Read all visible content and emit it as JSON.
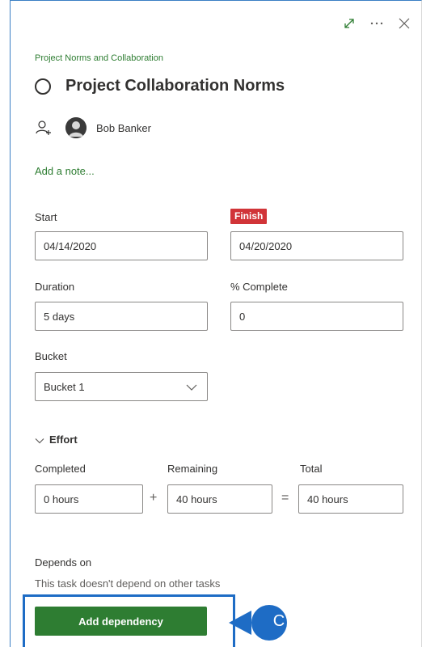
{
  "plan": {
    "name": "Project Norms and Collaboration"
  },
  "task": {
    "title": "Project Collaboration Norms",
    "assignee": "Bob Banker",
    "add_note_link": "Add a note..."
  },
  "dates": {
    "start_label": "Start",
    "start_value": "04/14/2020",
    "finish_label": "Finish",
    "finish_value": "04/20/2020"
  },
  "progress": {
    "duration_label": "Duration",
    "duration_value": "5 days",
    "complete_label": "% Complete",
    "complete_value": "0"
  },
  "bucket": {
    "label": "Bucket",
    "value": "Bucket 1"
  },
  "effort": {
    "section_title": "Effort",
    "completed_label": "Completed",
    "completed_value": "0 hours",
    "remaining_label": "Remaining",
    "remaining_value": "40 hours",
    "total_label": "Total",
    "total_value": "40 hours",
    "plus_sign": "+",
    "equals_sign": "="
  },
  "dependencies": {
    "label": "Depends on",
    "empty_text": "This task doesn't depend on other tasks",
    "add_button": "Add dependency"
  },
  "callout": {
    "letter": "C"
  },
  "icons": {
    "expand": "expand-diagonal-icon",
    "more": "more-ellipsis-icon",
    "close": "close-icon",
    "assign": "assign-person-icon",
    "chevron": "chevron-down-icon"
  },
  "colors": {
    "accent_green": "#2e7d32",
    "finish_red": "#d13438",
    "highlight_blue": "#1e6cc5"
  }
}
